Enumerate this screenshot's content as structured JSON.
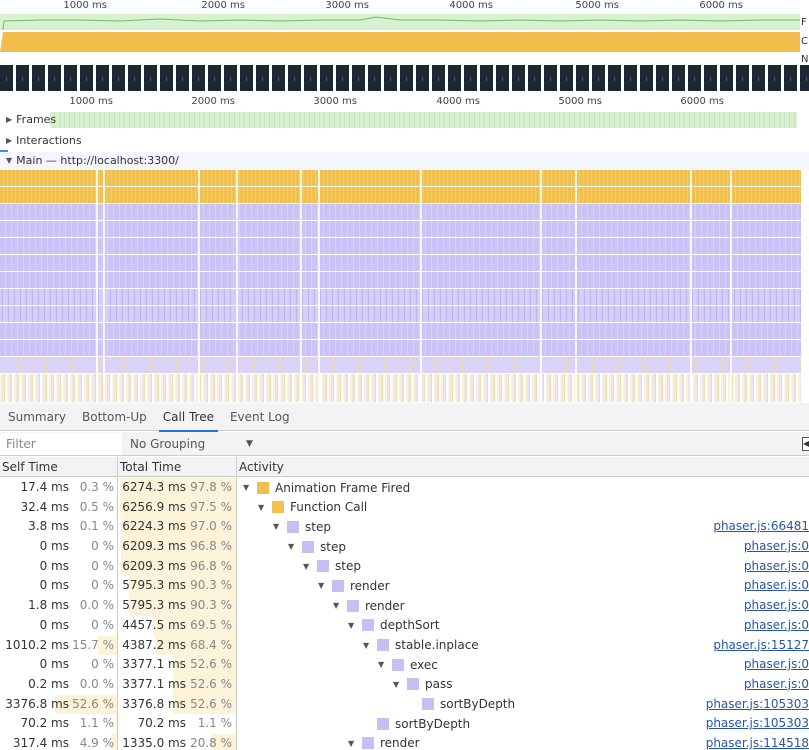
{
  "overview": {
    "ruler_ticks": [
      "1000 ms",
      "2000 ms",
      "3000 ms",
      "4000 ms",
      "5000 ms",
      "6000 ms"
    ],
    "track_labels": {
      "fps": "F",
      "cpu": "C",
      "net": "N"
    },
    "colors": {
      "fps": "#d8f1d2",
      "cpu": "#f0bd4c",
      "filmstrip": "#1c2833"
    }
  },
  "timeline": {
    "ruler_ticks": [
      "1000 ms",
      "2000 ms",
      "3000 ms",
      "4000 ms",
      "5000 ms",
      "6000 ms"
    ],
    "tracks": {
      "frames": "Frames",
      "interactions": "Interactions",
      "main": "Main — http://localhost:3300/"
    },
    "colors": {
      "scripting": "#f0c050",
      "rendering": "#cbc3f5",
      "frames": "#d7f0cf"
    }
  },
  "bottom_panel": {
    "tabs": [
      {
        "label": "Summary",
        "active": false
      },
      {
        "label": "Bottom-Up",
        "active": false
      },
      {
        "label": "Call Tree",
        "active": true
      },
      {
        "label": "Event Log",
        "active": false
      }
    ],
    "filter": {
      "placeholder": "Filter",
      "value": ""
    },
    "grouping": {
      "selected": "No Grouping"
    },
    "columns": {
      "self": "Self Time",
      "total": "Total Time",
      "activity": "Activity"
    },
    "rows": [
      {
        "self_ms": "17.4 ms",
        "self_pct": "0.3 %",
        "self_frac": 0.003,
        "total_ms": "6274.3 ms",
        "total_pct": "97.8 %",
        "total_frac": 0.978,
        "depth": 0,
        "expanded": true,
        "name": "Animation Frame Fired",
        "color": "#f0c050",
        "source": ""
      },
      {
        "self_ms": "32.4 ms",
        "self_pct": "0.5 %",
        "self_frac": 0.005,
        "total_ms": "6256.9 ms",
        "total_pct": "97.5 %",
        "total_frac": 0.975,
        "depth": 1,
        "expanded": true,
        "name": "Function Call",
        "color": "#f0c050",
        "source": ""
      },
      {
        "self_ms": "3.8 ms",
        "self_pct": "0.1 %",
        "self_frac": 0.001,
        "total_ms": "6224.3 ms",
        "total_pct": "97.0 %",
        "total_frac": 0.97,
        "depth": 2,
        "expanded": true,
        "name": "step",
        "color": "#c6bff3",
        "source": "phaser.js:66481"
      },
      {
        "self_ms": "0 ms",
        "self_pct": "0 %",
        "self_frac": 0,
        "total_ms": "6209.3 ms",
        "total_pct": "96.8 %",
        "total_frac": 0.968,
        "depth": 3,
        "expanded": true,
        "name": "step",
        "color": "#c6bff3",
        "source": "phaser.js:0"
      },
      {
        "self_ms": "0 ms",
        "self_pct": "0 %",
        "self_frac": 0,
        "total_ms": "6209.3 ms",
        "total_pct": "96.8 %",
        "total_frac": 0.968,
        "depth": 4,
        "expanded": true,
        "name": "step",
        "color": "#c6bff3",
        "source": "phaser.js:0"
      },
      {
        "self_ms": "0 ms",
        "self_pct": "0 %",
        "self_frac": 0,
        "total_ms": "5795.3 ms",
        "total_pct": "90.3 %",
        "total_frac": 0.903,
        "depth": 5,
        "expanded": true,
        "name": "render",
        "color": "#c6bff3",
        "source": "phaser.js:0"
      },
      {
        "self_ms": "1.8 ms",
        "self_pct": "0.0 %",
        "self_frac": 0.0,
        "total_ms": "5795.3 ms",
        "total_pct": "90.3 %",
        "total_frac": 0.903,
        "depth": 6,
        "expanded": true,
        "name": "render",
        "color": "#c6bff3",
        "source": "phaser.js:0"
      },
      {
        "self_ms": "0 ms",
        "self_pct": "0 %",
        "self_frac": 0,
        "total_ms": "4457.5 ms",
        "total_pct": "69.5 %",
        "total_frac": 0.695,
        "depth": 7,
        "expanded": true,
        "name": "depthSort",
        "color": "#c6bff3",
        "source": "phaser.js:0"
      },
      {
        "self_ms": "1010.2 ms",
        "self_pct": "15.7 %",
        "self_frac": 0.157,
        "total_ms": "4387.2 ms",
        "total_pct": "68.4 %",
        "total_frac": 0.684,
        "depth": 8,
        "expanded": true,
        "name": "stable.inplace",
        "color": "#c6bff3",
        "source": "phaser.js:15127"
      },
      {
        "self_ms": "0 ms",
        "self_pct": "0 %",
        "self_frac": 0,
        "total_ms": "3377.1 ms",
        "total_pct": "52.6 %",
        "total_frac": 0.526,
        "depth": 9,
        "expanded": true,
        "name": "exec",
        "color": "#c6bff3",
        "source": "phaser.js:0"
      },
      {
        "self_ms": "0.2 ms",
        "self_pct": "0.0 %",
        "self_frac": 0.0,
        "total_ms": "3377.1 ms",
        "total_pct": "52.6 %",
        "total_frac": 0.526,
        "depth": 10,
        "expanded": true,
        "name": "pass",
        "color": "#c6bff3",
        "source": "phaser.js:0"
      },
      {
        "self_ms": "3376.8 ms",
        "self_pct": "52.6 %",
        "self_frac": 0.526,
        "total_ms": "3376.8 ms",
        "total_pct": "52.6 %",
        "total_frac": 0.526,
        "depth": 11,
        "expanded": null,
        "name": "sortByDepth",
        "color": "#c6bff3",
        "source": "phaser.js:105303"
      },
      {
        "self_ms": "70.2 ms",
        "self_pct": "1.1 %",
        "self_frac": 0.011,
        "total_ms": "70.2 ms",
        "total_pct": "1.1 %",
        "total_frac": 0.011,
        "depth": 8,
        "expanded": null,
        "name": "sortByDepth",
        "color": "#c6bff3",
        "source": "phaser.js:105303"
      },
      {
        "self_ms": "317.4 ms",
        "self_pct": "4.9 %",
        "self_frac": 0.049,
        "total_ms": "1335.0 ms",
        "total_pct": "20.8 %",
        "total_frac": 0.208,
        "depth": 7,
        "expanded": true,
        "name": "render",
        "color": "#c6bff3",
        "source": "phaser.js:114518"
      }
    ]
  }
}
